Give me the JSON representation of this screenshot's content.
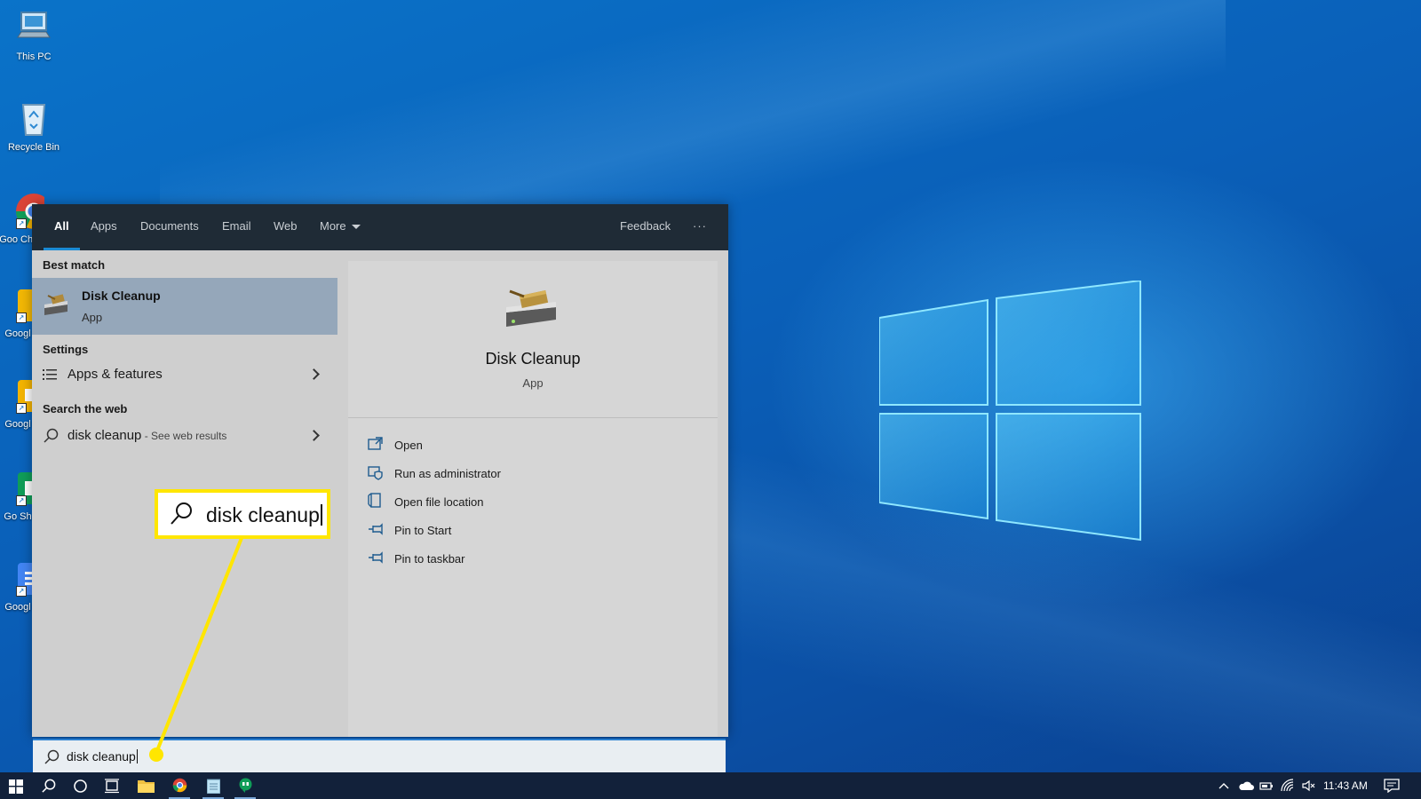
{
  "desktop_icons": [
    {
      "name": "this-pc",
      "label": "This PC"
    },
    {
      "name": "recycle-bin",
      "label": "Recycle Bin"
    },
    {
      "name": "google-chrome",
      "label": "Goo Chr"
    },
    {
      "name": "google-1",
      "label": "Googl"
    },
    {
      "name": "google-2",
      "label": "Googl"
    },
    {
      "name": "google-sheets",
      "label": "Go Sh"
    },
    {
      "name": "google-docs",
      "label": "Googl"
    }
  ],
  "tabs": {
    "all": "All",
    "apps": "Apps",
    "documents": "Documents",
    "email": "Email",
    "web": "Web",
    "more": "More",
    "feedback": "Feedback",
    "ellipsis": "···"
  },
  "results": {
    "best_match_heading": "Best match",
    "best_match_title": "Disk Cleanup",
    "best_match_type": "App",
    "settings_heading": "Settings",
    "settings_item": "Apps & features",
    "web_heading": "Search the web",
    "web_query": "disk cleanup",
    "web_suffix": " - See web results"
  },
  "detail": {
    "title": "Disk Cleanup",
    "type": "App",
    "actions": [
      "Open",
      "Run as administrator",
      "Open file location",
      "Pin to Start",
      "Pin to taskbar"
    ]
  },
  "search": {
    "query": "disk cleanup"
  },
  "callout": {
    "query": "disk cleanup"
  },
  "taskbar": {
    "clock": "11:43 AM"
  },
  "colors": {
    "accent": "#1a8ad4",
    "highlight": "#ffe600",
    "taskbar": "#12213a"
  }
}
